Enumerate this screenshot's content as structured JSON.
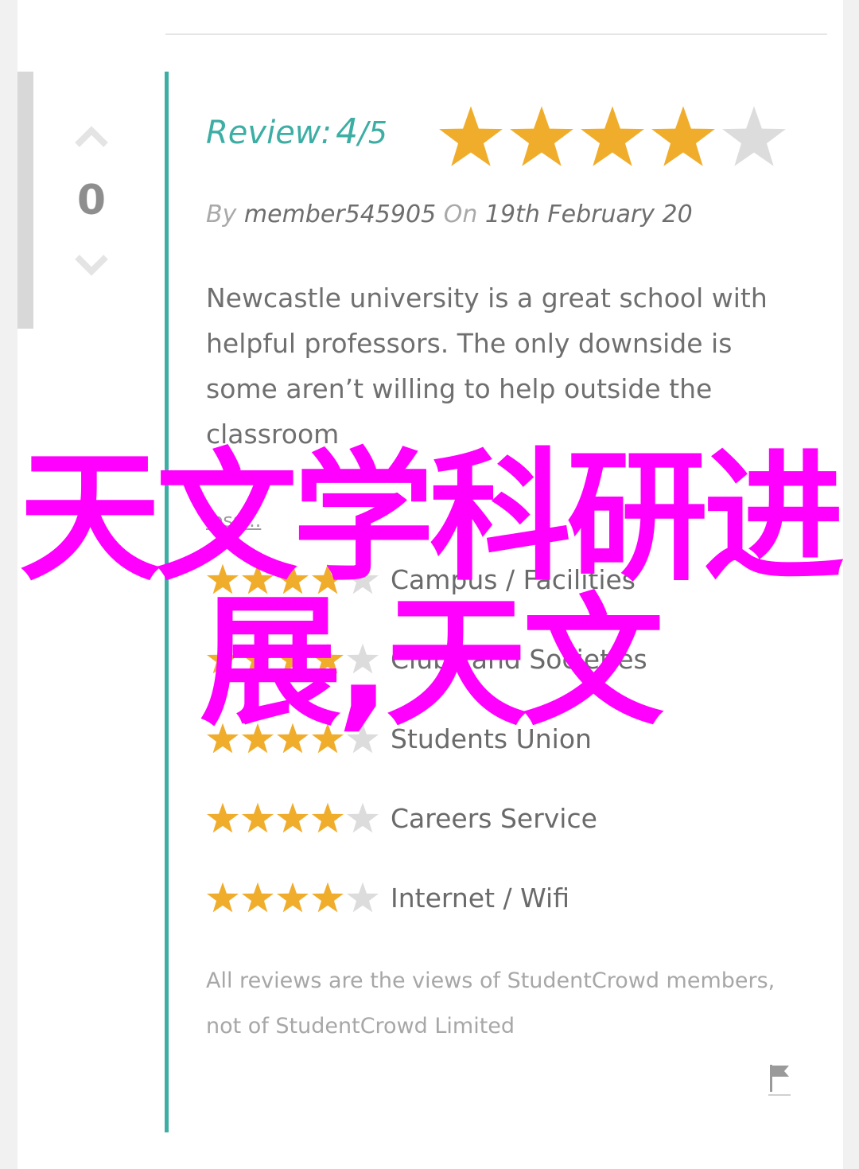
{
  "colors": {
    "accent": "#3daea4",
    "star_filled": "#f0ad2c",
    "star_empty": "#dcdcdc",
    "overlay": "#ff00ff"
  },
  "votes": {
    "count": "0",
    "up_icon": "chevron-up-icon",
    "down_icon": "chevron-down-icon"
  },
  "review": {
    "title_label": "Review:",
    "score": "4",
    "out_of": "/5",
    "rating_value": 4,
    "rating_max": 5,
    "by_label": "By",
    "author": "member545905",
    "on_label": "On",
    "date": "19th February 20",
    "body": "Newcastle university is a great school with helpful professors. The only downside is some aren’t willing to help outside the classroom",
    "less_link": "less..."
  },
  "categories": [
    {
      "label": "Campus / Facilities",
      "rating": 4
    },
    {
      "label": "Clubs and Societies",
      "rating": 4
    },
    {
      "label": "Students Union",
      "rating": 4
    },
    {
      "label": "Careers Service",
      "rating": 4
    },
    {
      "label": "Internet / Wifi",
      "rating": 4
    }
  ],
  "disclaimer": "All reviews are the views of StudentCrowd members, not of StudentCrowd Limited",
  "flag_icon": "flag-icon",
  "overlay_text": "天文学科研进展,天文"
}
